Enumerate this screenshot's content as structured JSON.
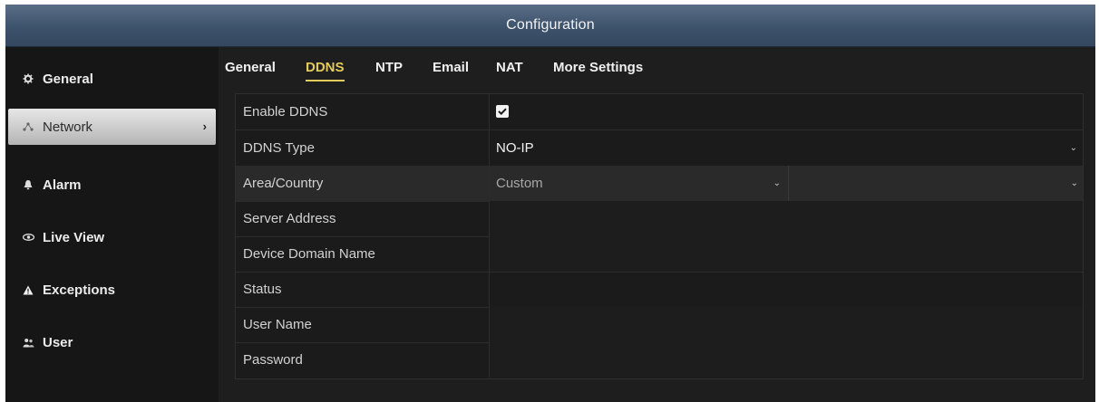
{
  "window": {
    "title": "Configuration"
  },
  "sidebar": {
    "items": [
      {
        "label": "General",
        "icon": "gear-icon"
      },
      {
        "label": "Network",
        "icon": "network-icon"
      },
      {
        "label": "Alarm",
        "icon": "alarm-icon"
      },
      {
        "label": "Live View",
        "icon": "eye-icon"
      },
      {
        "label": "Exceptions",
        "icon": "warning-icon"
      },
      {
        "label": "User",
        "icon": "users-icon"
      }
    ],
    "active": "Network"
  },
  "tabs": {
    "items": [
      "General",
      "DDNS",
      "NTP",
      "Email",
      "NAT",
      "More Settings"
    ],
    "active": "DDNS"
  },
  "form": {
    "enable_ddns": {
      "label": "Enable DDNS",
      "checked": true
    },
    "ddns_type": {
      "label": "DDNS Type",
      "value": "NO-IP"
    },
    "area_country": {
      "label": "Area/Country",
      "value": "Custom",
      "secondary_value": ""
    },
    "server_address": {
      "label": "Server Address",
      "value": ""
    },
    "device_domain_name": {
      "label": "Device Domain Name",
      "value": ""
    },
    "status": {
      "label": "Status",
      "value": ""
    },
    "user_name": {
      "label": "User Name",
      "value": ""
    },
    "password": {
      "label": "Password",
      "value": ""
    }
  },
  "colors": {
    "accent": "#e3cc5c",
    "titlebar": "#3d526b",
    "background": "#1b1b1b"
  }
}
